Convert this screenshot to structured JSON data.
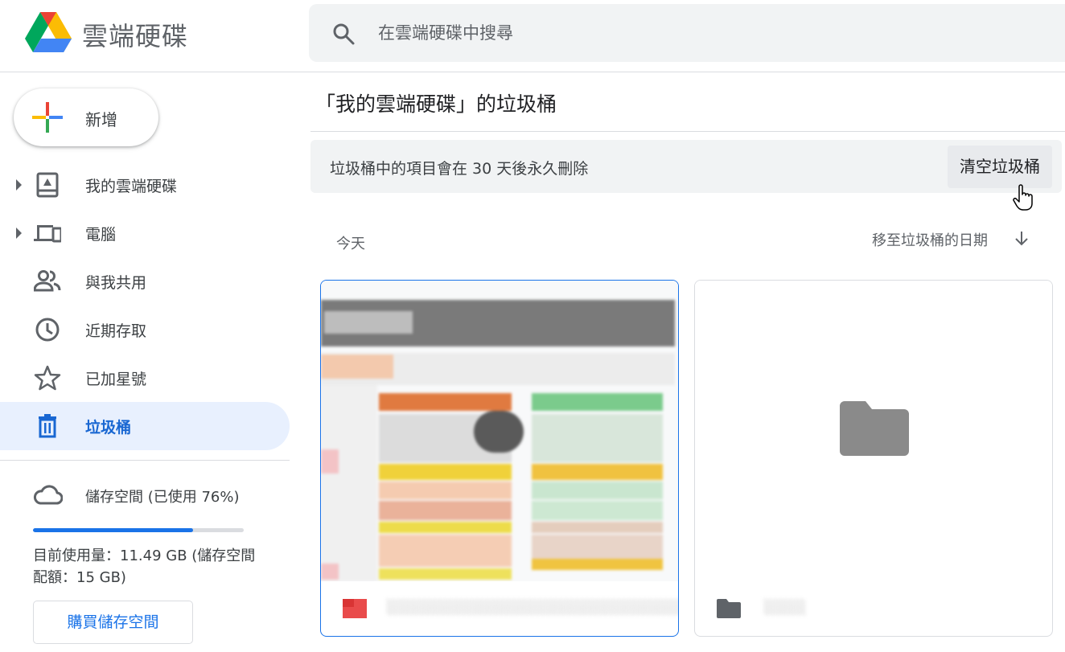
{
  "app": {
    "product_name": "雲端硬碟"
  },
  "search": {
    "placeholder": "在雲端硬碟中搜尋"
  },
  "sidebar": {
    "new_label": "新增",
    "items": [
      {
        "label": "我的雲端硬碟",
        "icon": "drive-icon",
        "expandable": true
      },
      {
        "label": "電腦",
        "icon": "computer-icon",
        "expandable": true
      },
      {
        "label": "與我共用",
        "icon": "people-icon",
        "expandable": false
      },
      {
        "label": "近期存取",
        "icon": "clock-icon",
        "expandable": false
      },
      {
        "label": "已加星號",
        "icon": "star-icon",
        "expandable": false
      },
      {
        "label": "垃圾桶",
        "icon": "trash-icon",
        "expandable": false,
        "active": true
      }
    ],
    "storage": {
      "label": "儲存空間 (已使用 76%)",
      "used_fraction": 0.76,
      "detail": "目前使用量：11.49 GB (儲存空間配額：15 GB)",
      "buy_label": "購買儲存空間"
    }
  },
  "main": {
    "title": "「我的雲端硬碟」的垃圾桶",
    "notice": "垃圾桶中的項目會在 30 天後永久刪除",
    "empty_trash_label": "清空垃圾桶",
    "section_label": "今天",
    "sort_label": "移至垃圾桶的日期",
    "files": [
      {
        "name": "░░░░░░░░░░░░░░░░░░░░░░░░░░░░░░░",
        "type": "spreadsheet",
        "selected": true
      },
      {
        "name": "░░░░",
        "type": "folder",
        "selected": false
      }
    ]
  },
  "colors": {
    "accent": "#1a73e8",
    "active_bg": "#e8f0fe",
    "search_bg": "#f1f3f4",
    "folder_gray": "#8a8a8a"
  }
}
